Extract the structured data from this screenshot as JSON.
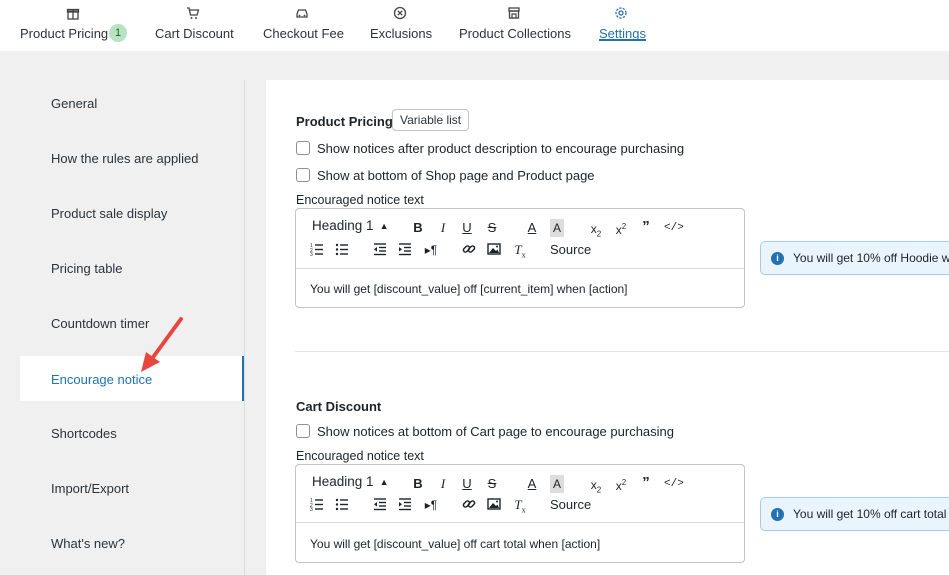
{
  "tabs": [
    {
      "label": "Product Pricing",
      "icon": "gift-icon",
      "badge": "1"
    },
    {
      "label": "Cart Discount",
      "icon": "cart-icon"
    },
    {
      "label": "Checkout Fee",
      "icon": "car-icon"
    },
    {
      "label": "Exclusions",
      "icon": "circle-x-icon"
    },
    {
      "label": "Product Collections",
      "icon": "store-icon"
    },
    {
      "label": "Settings",
      "icon": "gear-icon",
      "active": true
    }
  ],
  "sidebar": {
    "items": [
      {
        "label": "General"
      },
      {
        "label": "How the rules are applied"
      },
      {
        "label": "Product sale display"
      },
      {
        "label": "Pricing table"
      },
      {
        "label": "Countdown timer"
      },
      {
        "label": "Encourage notice",
        "active": true
      },
      {
        "label": "Shortcodes"
      },
      {
        "label": "Import/Export"
      },
      {
        "label": "What's new?"
      }
    ]
  },
  "product_pricing": {
    "title": "Product Pricing",
    "variable_button": "Variable list",
    "checkbox_1": "Show notices after product description to encourage purchasing",
    "checkbox_2": "Show at bottom of Shop page and Product page",
    "field_label": "Encouraged notice text",
    "heading_select": "Heading 1",
    "source_label": "Source",
    "content": "You will get [discount_value] off [current_item] when [action]",
    "preview": "You will get 10% off Hoodie w"
  },
  "cart_discount": {
    "title": "Cart Discount",
    "checkbox_1": "Show notices at bottom of Cart page to encourage purchasing",
    "field_label": "Encouraged notice text",
    "heading_select": "Heading 1",
    "source_label": "Source",
    "content": "You will get [discount_value] off cart total when [action]",
    "preview": "You will get 10% off cart total w"
  },
  "colors": {
    "accent": "#2271b1",
    "arrow": "#e8473f",
    "badge_bg": "#b8e3c2",
    "notice_bg": "#eaf4fc"
  }
}
